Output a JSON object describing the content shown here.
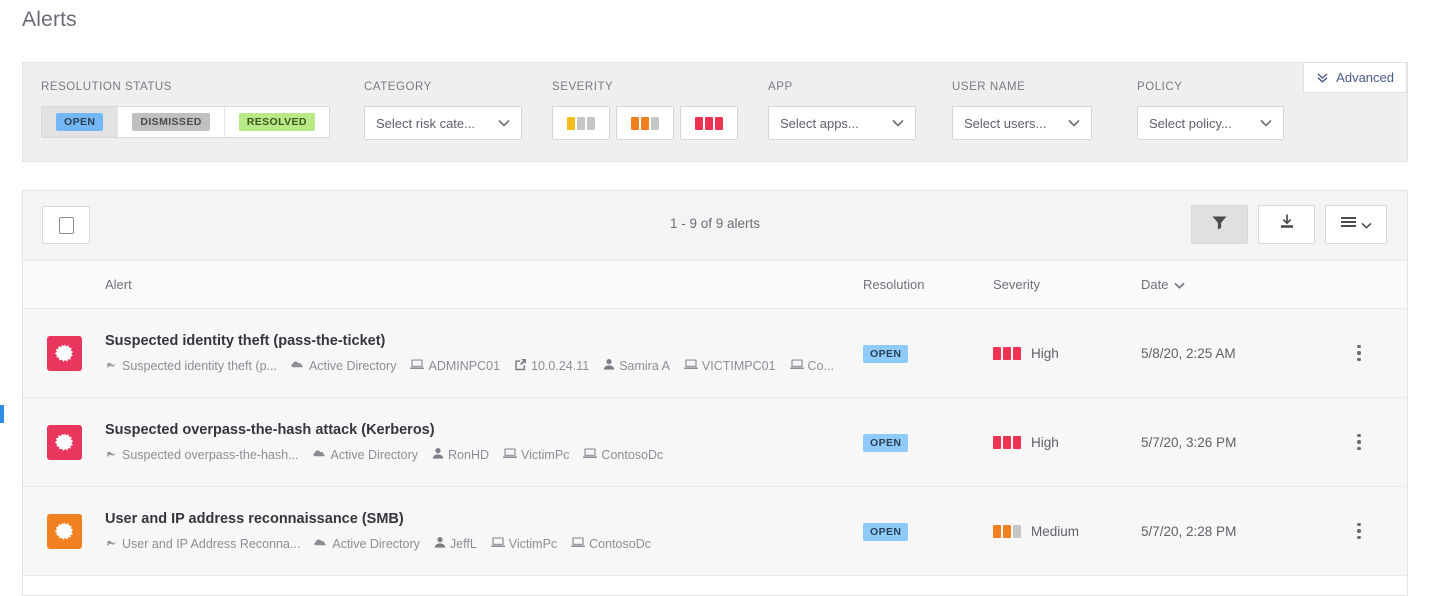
{
  "page": {
    "title": "Alerts"
  },
  "filters": {
    "advanced": {
      "label": "Advanced",
      "icon": "double-chevron-down-icon"
    },
    "resolution_status": {
      "label": "RESOLUTION STATUS",
      "options": [
        {
          "label": "OPEN",
          "selected": true
        },
        {
          "label": "DISMISSED",
          "selected": false
        },
        {
          "label": "RESOLVED",
          "selected": false
        }
      ]
    },
    "category": {
      "label": "CATEGORY",
      "placeholder": "Select risk cate...",
      "value": "Select risk cate..."
    },
    "severity": {
      "label": "SEVERITY",
      "options": [
        {
          "name": "low",
          "filled": 1,
          "color": "#f5bc1e"
        },
        {
          "name": "medium",
          "filled": 2,
          "color": "#f08020"
        },
        {
          "name": "high",
          "filled": 3,
          "color": "#ef3352"
        }
      ]
    },
    "app": {
      "label": "APP",
      "value": "Select apps..."
    },
    "user_name": {
      "label": "USER NAME",
      "value": "Select users..."
    },
    "policy": {
      "label": "POLICY",
      "value": "Select policy..."
    }
  },
  "table": {
    "toolbar": {
      "count_text": "1 - 9 of 9 alerts",
      "filter_button": "filter-icon",
      "export_button": "download-icon",
      "view_button": "list-view-icon"
    },
    "columns": {
      "alert": "Alert",
      "resolution": "Resolution",
      "severity": "Severity",
      "date": "Date"
    },
    "rows": [
      {
        "title": "Suspected identity theft (pass-the-ticket)",
        "severity_level": "high",
        "severity_label": "High",
        "severity_filled": 3,
        "severity_color": "#ef3352",
        "resolution": "OPEN",
        "date": "5/8/20, 2:25 AM",
        "meta": [
          {
            "icon": "policy-icon",
            "text": "Suspected identity theft (p..."
          },
          {
            "icon": "cloud-icon",
            "text": "Active Directory"
          },
          {
            "icon": "computer-icon",
            "text": "ADMINPC01"
          },
          {
            "icon": "external-link-icon",
            "text": "10.0.24.11"
          },
          {
            "icon": "user-icon",
            "text": "Samira A"
          },
          {
            "icon": "computer-icon",
            "text": "VICTIMPC01"
          },
          {
            "icon": "computer-icon",
            "text": "Co..."
          }
        ]
      },
      {
        "title": "Suspected overpass-the-hash attack (Kerberos)",
        "severity_level": "high",
        "severity_label": "High",
        "severity_filled": 3,
        "severity_color": "#ef3352",
        "resolution": "OPEN",
        "date": "5/7/20, 3:26 PM",
        "meta": [
          {
            "icon": "policy-icon",
            "text": "Suspected overpass-the-hash..."
          },
          {
            "icon": "cloud-icon",
            "text": "Active Directory"
          },
          {
            "icon": "user-icon",
            "text": "RonHD"
          },
          {
            "icon": "computer-icon",
            "text": "VictimPc"
          },
          {
            "icon": "computer-icon",
            "text": "ContosoDc"
          }
        ]
      },
      {
        "title": "User and IP address reconnaissance (SMB)",
        "severity_level": "medium",
        "severity_label": "Medium",
        "severity_filled": 2,
        "severity_color": "#f08020",
        "resolution": "OPEN",
        "date": "5/7/20, 2:28 PM",
        "meta": [
          {
            "icon": "policy-icon",
            "text": "User and IP Address Reconna..."
          },
          {
            "icon": "cloud-icon",
            "text": "Active Directory"
          },
          {
            "icon": "user-icon",
            "text": "JeffL"
          },
          {
            "icon": "computer-icon",
            "text": "VictimPc"
          },
          {
            "icon": "computer-icon",
            "text": "ContosoDc"
          }
        ]
      }
    ]
  }
}
